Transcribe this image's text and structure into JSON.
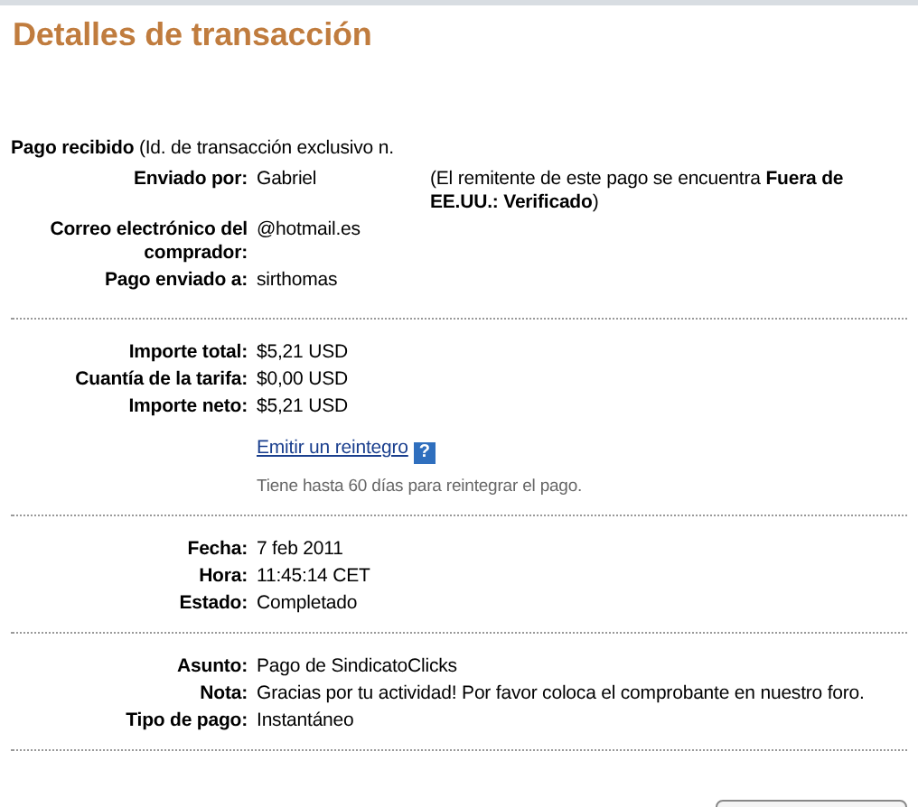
{
  "title": "Detalles de transacción",
  "intro": "**Pago recibido** (Id. de transacción exclusivo n.",
  "sections": [
    {
      "rows": [
        {
          "kind": "field",
          "label": "Enviado por:",
          "value": "Gabriel",
          "note": "(El remitente de este pago se encuentra **Fuera de EE.UU.: Verificado**)"
        },
        {
          "kind": "field",
          "label": "Correo electrónico del comprador:",
          "value": "@hotmail.es"
        },
        {
          "kind": "field",
          "label": "Pago enviado a:",
          "value": "sirthomas"
        }
      ]
    },
    {
      "rows": [
        {
          "kind": "field",
          "label": "Importe total:",
          "value": "$5,21 USD"
        },
        {
          "kind": "field",
          "label": "Cuantía de la tarifa:",
          "value": "$0,00 USD"
        },
        {
          "kind": "field",
          "label": "Importe neto:",
          "value": "$5,21 USD"
        },
        {
          "kind": "link",
          "value": "Emitir un reintegro",
          "help": "?"
        },
        {
          "kind": "hint",
          "value": "Tiene hasta 60 días para reintegrar el pago."
        }
      ]
    },
    {
      "rows": [
        {
          "kind": "field",
          "label": "Fecha:",
          "value": "7 feb 2011"
        },
        {
          "kind": "field",
          "label": "Hora:",
          "value": "11:45:14 CET"
        },
        {
          "kind": "field",
          "label": "Estado:",
          "value": "Completado"
        }
      ]
    },
    {
      "rows": [
        {
          "kind": "field",
          "label": "Asunto:",
          "value": "Pago de SindicatoClicks"
        },
        {
          "kind": "field",
          "label": "Nota:",
          "value": "Gracias por tu actividad! Por favor coloca el comprobante en nuestro foro."
        },
        {
          "kind": "field",
          "label": "Tipo de pago:",
          "value": "Instantáneo"
        }
      ]
    }
  ]
}
